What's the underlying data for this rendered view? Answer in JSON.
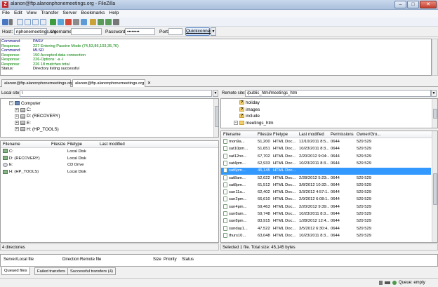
{
  "window": {
    "title": "alanon@ftp.alanonphonemeetings.org - FileZilla",
    "minimize": "–",
    "maximize": "□",
    "close": "✕"
  },
  "menu": [
    "File",
    "Edit",
    "View",
    "Transfer",
    "Server",
    "Bookmarks",
    "Help"
  ],
  "quickconnect": {
    "host_label": "Host:",
    "host_value": "nphonemeetings.org",
    "username_label": "Username:",
    "username_value": "",
    "password_label": "Password:",
    "password_value": "••••••••",
    "port_label": "Port:",
    "port_value": "",
    "button": "Quickconnect",
    "dropdown": "▼"
  },
  "log": [
    {
      "type": "Command:",
      "text": "PASV",
      "kind": "cmd"
    },
    {
      "type": "Response:",
      "text": "227 Entering Passive Mode (74,53,86,103,35,76)",
      "kind": "resp"
    },
    {
      "type": "Command:",
      "text": "MLSD",
      "kind": "cmd"
    },
    {
      "type": "Response:",
      "text": "150 Accepted data connection",
      "kind": "resp"
    },
    {
      "type": "Response:",
      "text": "226-Options: -a -l",
      "kind": "resp"
    },
    {
      "type": "Response:",
      "text": "226 18 matches total",
      "kind": "resp"
    },
    {
      "type": "Status:",
      "text": "Directory listing successful",
      "kind": "stat"
    }
  ],
  "tabs": [
    {
      "label": "alanon@ftp.alanonphonemeetings.org",
      "close": ""
    },
    {
      "label": "alanon@ftp.alanonphonemeetings.org",
      "close": "✕"
    }
  ],
  "local": {
    "site_label": "Local site:",
    "site_value": "\\",
    "tree": [
      {
        "label": "Computer",
        "expander": "−",
        "icon": "computer"
      },
      {
        "label": "C:",
        "expander": "+",
        "icon": "drive"
      },
      {
        "label": "D: (RECOVERY)",
        "expander": "+",
        "icon": "drive"
      },
      {
        "label": "E:",
        "expander": "+",
        "icon": "drive"
      },
      {
        "label": "H: (HP_TOOLS)",
        "expander": "+",
        "icon": "drive"
      }
    ],
    "columns": [
      "Filename",
      "Filesize",
      "Filetype",
      "Last modified"
    ],
    "sort_arrow": "ˆ",
    "files": [
      {
        "name": "C:",
        "size": "",
        "type": "Local Disk",
        "modified": "",
        "icon": "disk"
      },
      {
        "name": "D: (RECOVERY)",
        "size": "",
        "type": "Local Disk",
        "modified": "",
        "icon": "disk"
      },
      {
        "name": "E:",
        "size": "",
        "type": "CD Drive",
        "modified": "",
        "icon": "cd"
      },
      {
        "name": "H: (HP_TOOLS)",
        "size": "",
        "type": "Local Disk",
        "modified": "",
        "icon": "disk"
      }
    ],
    "status": "4 directories"
  },
  "remote": {
    "site_label": "Remote site:",
    "site_value": "/public_html/meetings_htm",
    "tree": [
      {
        "label": "holiday",
        "icon": "unknown",
        "expander": ""
      },
      {
        "label": "images",
        "icon": "unknown",
        "expander": ""
      },
      {
        "label": "include",
        "icon": "unknown",
        "expander": ""
      },
      {
        "label": "meetings_htm",
        "icon": "folder",
        "expander": "−"
      }
    ],
    "columns": [
      "Filename",
      "Filesize",
      "Filetype",
      "Last modified",
      "Permissions",
      "Owner/Gro..."
    ],
    "sort_arrow": "ˆ",
    "files": [
      {
        "name": "mon9a...",
        "size": "51,200",
        "type": "HTML Doc...",
        "modified": "12/10/2011 8:5...",
        "perm": "0644",
        "owner": "529 529"
      },
      {
        "name": "sat10pm...",
        "size": "51,651",
        "type": "HTML Doc...",
        "modified": "10/23/2011 8:3...",
        "perm": "0644",
        "owner": "529 529"
      },
      {
        "name": "sat12no...",
        "size": "67,702",
        "type": "HTML Doc...",
        "modified": "2/20/2012 9:04:...",
        "perm": "0644",
        "owner": "529 529"
      },
      {
        "name": "sat4pm...",
        "size": "62,933",
        "type": "HTML Doc...",
        "modified": "10/23/2011 8:3...",
        "perm": "0644",
        "owner": "529 529"
      },
      {
        "name": "sat6pm...",
        "size": "45,145",
        "type": "HTML Doc...",
        "modified": "",
        "perm": "",
        "owner": "",
        "selected": true
      },
      {
        "name": "sat8am...",
        "size": "52,622",
        "type": "HTML Doc...",
        "modified": "2/28/2012 5:23:...",
        "perm": "0644",
        "owner": "529 529"
      },
      {
        "name": "sat8pm...",
        "size": "61,512",
        "type": "HTML Doc...",
        "modified": "3/8/2012 10:32:...",
        "perm": "0644",
        "owner": "529 529"
      },
      {
        "name": "sun11a...",
        "size": "62,402",
        "type": "HTML Doc...",
        "modified": "3/3/2012 4:57:1...",
        "perm": "0644",
        "owner": "529 529"
      },
      {
        "name": "sun2pm...",
        "size": "66,610",
        "type": "HTML Doc...",
        "modified": "2/9/2012 6:08:1...",
        "perm": "0644",
        "owner": "529 529"
      },
      {
        "name": "sun4pm...",
        "size": "59,463",
        "type": "HTML Doc...",
        "modified": "2/20/2012 9:39:...",
        "perm": "0644",
        "owner": "529 529"
      },
      {
        "name": "sun8am...",
        "size": "59,748",
        "type": "HTML Doc...",
        "modified": "10/23/2011 8:3...",
        "perm": "0644",
        "owner": "529 529"
      },
      {
        "name": "sun8pm...",
        "size": "83,915",
        "type": "HTML Doc...",
        "modified": "1/28/2012 12:4...",
        "perm": "0644",
        "owner": "529 529"
      },
      {
        "name": "sunday1...",
        "size": "47,522",
        "type": "HTML Doc...",
        "modified": "3/5/2012 6:30:4...",
        "perm": "0644",
        "owner": "529 529"
      },
      {
        "name": "thurs10...",
        "size": "63,048",
        "type": "HTML Doc...",
        "modified": "10/23/2011 8:3...",
        "perm": "0644",
        "owner": "529 529"
      }
    ],
    "status": "Selected 1 file. Total size: 45,145 bytes"
  },
  "queue": {
    "columns": [
      "Server/Local file",
      "Direction",
      "Remote file",
      "Size",
      "Priority",
      "Status"
    ],
    "tabs": [
      "Queued files",
      "Failed transfers",
      "Successful transfers (4)"
    ]
  },
  "statusbar": {
    "queue": "Queue: empty"
  }
}
